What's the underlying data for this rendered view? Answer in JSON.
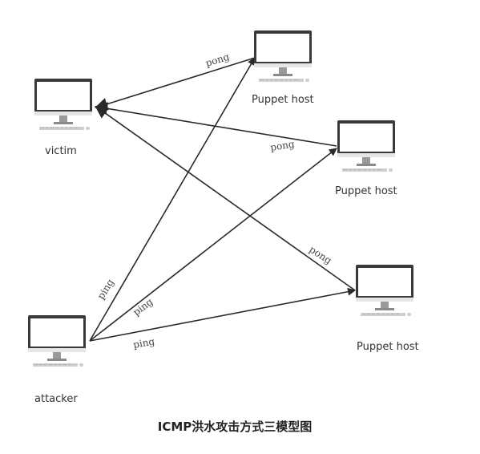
{
  "title": "ICMP洪水攻击方式三模型图",
  "nodes": {
    "victim": {
      "label": "victim"
    },
    "attacker": {
      "label": "attacker"
    },
    "puppet1": {
      "label": "Puppet host"
    },
    "puppet2": {
      "label": "Puppet host"
    },
    "puppet3": {
      "label": "Puppet host"
    }
  },
  "edges": {
    "ping1": {
      "label": "ping"
    },
    "ping2": {
      "label": "ping"
    },
    "ping3": {
      "label": "ping"
    },
    "pong1": {
      "label": "pong"
    },
    "pong2": {
      "label": "pong"
    },
    "pong3": {
      "label": "pong"
    }
  },
  "colors": {
    "monitor_frame": "#3a3a3a",
    "monitor_screen": "#ffffff",
    "stand": "#9a9a9a",
    "keyboard": "#cfcfcf",
    "arrow": "#2a2a2a"
  }
}
